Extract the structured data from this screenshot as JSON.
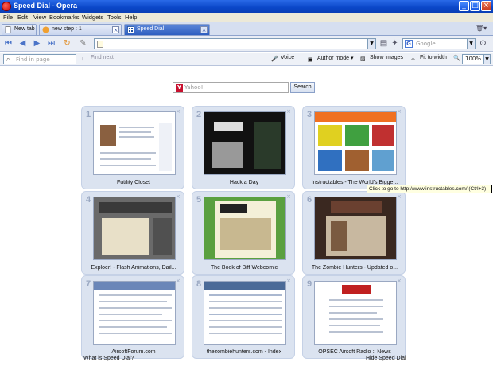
{
  "window": {
    "title": "Speed Dial - Opera"
  },
  "menu": [
    "File",
    "Edit",
    "View",
    "Bookmarks",
    "Widgets",
    "Tools",
    "Help"
  ],
  "tabs": [
    {
      "label": "New tab",
      "closable": false
    },
    {
      "label": "new step : 1",
      "closable": true
    },
    {
      "label": "Speed Dial",
      "closable": true,
      "active": true
    }
  ],
  "navbar": {
    "address_value": "",
    "search_placeholder": "Google"
  },
  "findbar": {
    "find_placeholder": "Find in page",
    "find_next": "Find next",
    "voice": "Voice",
    "author_mode": "Author mode",
    "show_images": "Show images",
    "fit_to_width": "Fit to width",
    "zoom": "100%"
  },
  "speed_dial": {
    "search_placeholder": "Yahoo!",
    "search_button": "Search",
    "dials": [
      {
        "number": "1",
        "caption": "Futility Closet"
      },
      {
        "number": "2",
        "caption": "Hack a Day"
      },
      {
        "number": "3",
        "caption": "Instructables - The World's Bigge..."
      },
      {
        "number": "4",
        "caption": "Exploer! - Flash Animations, Dail..."
      },
      {
        "number": "5",
        "caption": "The Book of Biff Webcomic"
      },
      {
        "number": "6",
        "caption": "The Zombie Hunters - Updated o..."
      },
      {
        "number": "7",
        "caption": "AirsoftForum.com"
      },
      {
        "number": "8",
        "caption": "thezombiehunters.com - Index"
      },
      {
        "number": "9",
        "caption": "OPSEC Airsoft Radio :: News"
      }
    ],
    "tooltip": "Click to go to http://www.instructables.com/ (Ctrl+3)",
    "footer_left": "What is Speed Dial?",
    "footer_right": "Hide Speed Dial"
  }
}
